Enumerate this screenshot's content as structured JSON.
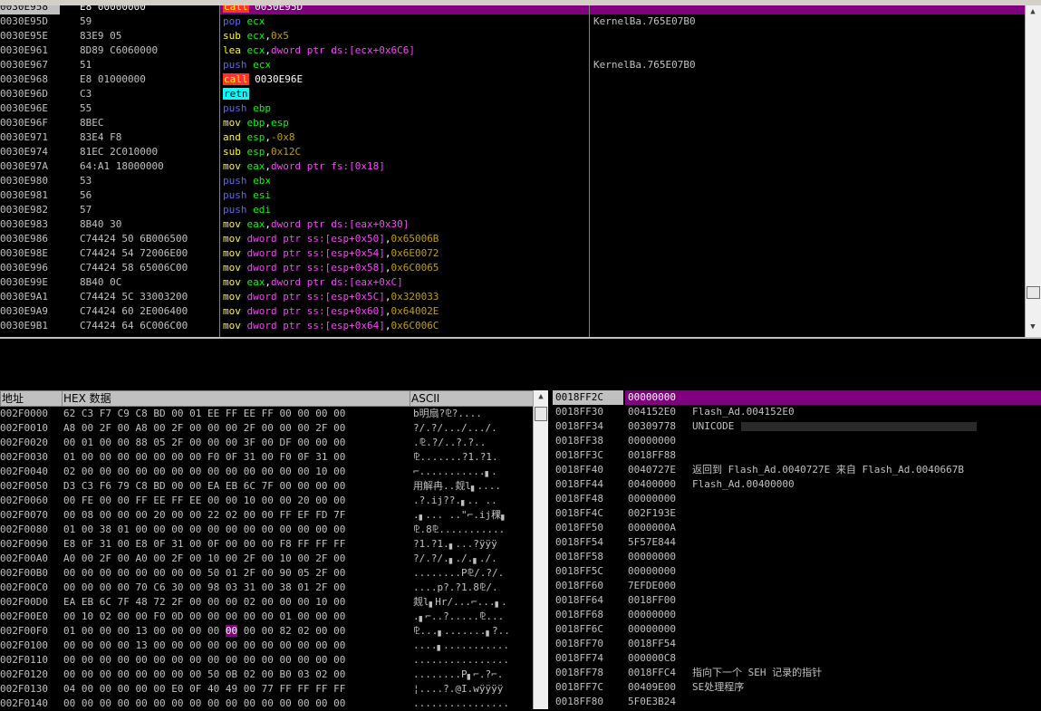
{
  "disasm": {
    "rows": [
      {
        "addr": "0030E958",
        "hex": "E8 00000000",
        "asm": [
          {
            "t": "call",
            "c": "kw-call"
          },
          {
            "t": " 0030E95D",
            "c": "op-plain"
          }
        ],
        "comment": ""
      },
      {
        "addr": "0030E95D",
        "hex": "59",
        "asm": [
          {
            "t": "pop",
            "c": "kw-pop"
          },
          {
            "t": " ecx",
            "c": "op-reg"
          }
        ],
        "comment": "KernelBa.765E07B0"
      },
      {
        "addr": "0030E95E",
        "hex": "83E9 05",
        "asm": [
          {
            "t": "sub",
            "c": "kw-arith"
          },
          {
            "t": " ecx",
            "c": "op-reg"
          },
          {
            "t": ",",
            "c": "op-plain"
          },
          {
            "t": "0x5",
            "c": "op-imm"
          }
        ],
        "comment": ""
      },
      {
        "addr": "0030E961",
        "hex": "8D89 C6060000",
        "asm": [
          {
            "t": "lea",
            "c": "kw-mov"
          },
          {
            "t": " ecx",
            "c": "op-reg"
          },
          {
            "t": ",",
            "c": "op-plain"
          },
          {
            "t": "dword ptr ds:[ecx+0x6C6]",
            "c": "op-mem"
          }
        ],
        "comment": ""
      },
      {
        "addr": "0030E967",
        "hex": "51",
        "asm": [
          {
            "t": "push",
            "c": "kw-push"
          },
          {
            "t": " ecx",
            "c": "op-reg"
          }
        ],
        "comment": "KernelBa.765E07B0"
      },
      {
        "addr": "0030E968",
        "hex": "E8 01000000",
        "asm": [
          {
            "t": "call",
            "c": "kw-call"
          },
          {
            "t": " 0030E96E",
            "c": "op-plain"
          }
        ],
        "comment": ""
      },
      {
        "addr": "0030E96D",
        "hex": "C3",
        "asm": [
          {
            "t": "retn",
            "c": "kw-retn"
          }
        ],
        "comment": ""
      },
      {
        "addr": "0030E96E",
        "hex": "55",
        "asm": [
          {
            "t": "push",
            "c": "kw-push"
          },
          {
            "t": " ebp",
            "c": "op-reg"
          }
        ],
        "comment": ""
      },
      {
        "addr": "0030E96F",
        "hex": "8BEC",
        "asm": [
          {
            "t": "mov",
            "c": "kw-mov"
          },
          {
            "t": " ebp",
            "c": "op-reg"
          },
          {
            "t": ",",
            "c": "op-plain"
          },
          {
            "t": "esp",
            "c": "op-reg"
          }
        ],
        "comment": ""
      },
      {
        "addr": "0030E971",
        "hex": "83E4 F8",
        "asm": [
          {
            "t": "and",
            "c": "kw-arith"
          },
          {
            "t": " esp",
            "c": "op-reg"
          },
          {
            "t": ",",
            "c": "op-plain"
          },
          {
            "t": "-0x8",
            "c": "op-imm"
          }
        ],
        "comment": ""
      },
      {
        "addr": "0030E974",
        "hex": "81EC 2C010000",
        "asm": [
          {
            "t": "sub",
            "c": "kw-arith"
          },
          {
            "t": " esp",
            "c": "op-reg"
          },
          {
            "t": ",",
            "c": "op-plain"
          },
          {
            "t": "0x12C",
            "c": "op-imm"
          }
        ],
        "comment": ""
      },
      {
        "addr": "0030E97A",
        "hex": "64:A1 18000000",
        "asm": [
          {
            "t": "mov",
            "c": "kw-mov"
          },
          {
            "t": " eax",
            "c": "op-reg"
          },
          {
            "t": ",",
            "c": "op-plain"
          },
          {
            "t": "dword ptr fs:[0x18]",
            "c": "op-mem"
          }
        ],
        "comment": ""
      },
      {
        "addr": "0030E980",
        "hex": "53",
        "asm": [
          {
            "t": "push",
            "c": "kw-push"
          },
          {
            "t": " ebx",
            "c": "op-reg"
          }
        ],
        "comment": ""
      },
      {
        "addr": "0030E981",
        "hex": "56",
        "asm": [
          {
            "t": "push",
            "c": "kw-push"
          },
          {
            "t": " esi",
            "c": "op-reg"
          }
        ],
        "comment": ""
      },
      {
        "addr": "0030E982",
        "hex": "57",
        "asm": [
          {
            "t": "push",
            "c": "kw-push"
          },
          {
            "t": " edi",
            "c": "op-reg"
          }
        ],
        "comment": ""
      },
      {
        "addr": "0030E983",
        "hex": "8B40 30",
        "asm": [
          {
            "t": "mov",
            "c": "kw-mov"
          },
          {
            "t": " eax",
            "c": "op-reg"
          },
          {
            "t": ",",
            "c": "op-plain"
          },
          {
            "t": "dword ptr ds:[eax+0x30]",
            "c": "op-mem"
          }
        ],
        "comment": ""
      },
      {
        "addr": "0030E986",
        "hex": "C74424 50 6B006500",
        "asm": [
          {
            "t": "mov",
            "c": "kw-mov"
          },
          {
            "t": " dword ptr ss:[esp+0x50]",
            "c": "op-mem"
          },
          {
            "t": ",",
            "c": "op-plain"
          },
          {
            "t": "0x65006B",
            "c": "op-imm"
          }
        ],
        "comment": ""
      },
      {
        "addr": "0030E98E",
        "hex": "C74424 54 72006E00",
        "asm": [
          {
            "t": "mov",
            "c": "kw-mov"
          },
          {
            "t": " dword ptr ss:[esp+0x54]",
            "c": "op-mem"
          },
          {
            "t": ",",
            "c": "op-plain"
          },
          {
            "t": "0x6E0072",
            "c": "op-imm"
          }
        ],
        "comment": ""
      },
      {
        "addr": "0030E996",
        "hex": "C74424 58 65006C00",
        "asm": [
          {
            "t": "mov",
            "c": "kw-mov"
          },
          {
            "t": " dword ptr ss:[esp+0x58]",
            "c": "op-mem"
          },
          {
            "t": ",",
            "c": "op-plain"
          },
          {
            "t": "0x6C0065",
            "c": "op-imm"
          }
        ],
        "comment": ""
      },
      {
        "addr": "0030E99E",
        "hex": "8B40 0C",
        "asm": [
          {
            "t": "mov",
            "c": "kw-mov"
          },
          {
            "t": " eax",
            "c": "op-reg"
          },
          {
            "t": ",",
            "c": "op-plain"
          },
          {
            "t": "dword ptr ds:[eax+0xC]",
            "c": "op-mem"
          }
        ],
        "comment": ""
      },
      {
        "addr": "0030E9A1",
        "hex": "C74424 5C 33003200",
        "asm": [
          {
            "t": "mov",
            "c": "kw-mov"
          },
          {
            "t": " dword ptr ss:[esp+0x5C]",
            "c": "op-mem"
          },
          {
            "t": ",",
            "c": "op-plain"
          },
          {
            "t": "0x320033",
            "c": "op-imm"
          }
        ],
        "comment": ""
      },
      {
        "addr": "0030E9A9",
        "hex": "C74424 60 2E006400",
        "asm": [
          {
            "t": "mov",
            "c": "kw-mov"
          },
          {
            "t": " dword ptr ss:[esp+0x60]",
            "c": "op-mem"
          },
          {
            "t": ",",
            "c": "op-plain"
          },
          {
            "t": "0x64002E",
            "c": "op-imm"
          }
        ],
        "comment": ""
      },
      {
        "addr": "0030E9B1",
        "hex": "C74424 64 6C006C00",
        "asm": [
          {
            "t": "mov",
            "c": "kw-mov"
          },
          {
            "t": " dword ptr ss:[esp+0x64]",
            "c": "op-mem"
          },
          {
            "t": ",",
            "c": "op-plain"
          },
          {
            "t": "0x6C006C",
            "c": "op-imm"
          }
        ],
        "comment": ""
      }
    ]
  },
  "dump": {
    "header_addr": "地址",
    "header_hex": "HEX 数据",
    "header_ascii": "ASCII",
    "rows": [
      {
        "addr": "002F0000",
        "hex": [
          "62",
          "C3",
          "F7",
          "C9",
          "C8",
          "BD",
          "00",
          "01",
          "EE",
          "FF",
          "EE",
          "FF",
          "00",
          "00",
          "00",
          "00"
        ],
        "ascii": "b明扇?⅊?...."
      },
      {
        "addr": "002F0010",
        "hex": [
          "A8",
          "00",
          "2F",
          "00",
          "A8",
          "00",
          "2F",
          "00",
          "00",
          "00",
          "2F",
          "00",
          "00",
          "00",
          "2F",
          "00"
        ],
        "ascii": "?/.?/.../.../."
      },
      {
        "addr": "002F0020",
        "hex": [
          "00",
          "01",
          "00",
          "00",
          "88",
          "05",
          "2F",
          "00",
          "00",
          "00",
          "3F",
          "00",
          "DF",
          "00",
          "00",
          "00"
        ],
        "ascii": ".⅊.?/..?.?.."
      },
      {
        "addr": "002F0030",
        "hex": [
          "01",
          "00",
          "00",
          "00",
          "00",
          "00",
          "00",
          "00",
          "F0",
          "0F",
          "31",
          "00",
          "F0",
          "0F",
          "31",
          "00"
        ],
        "ascii": "⅊.......?1.?1."
      },
      {
        "addr": "002F0040",
        "hex": [
          "02",
          "00",
          "00",
          "00",
          "00",
          "00",
          "00",
          "00",
          "00",
          "00",
          "00",
          "00",
          "00",
          "00",
          "10",
          "00"
        ],
        "ascii": "⌐...........▖."
      },
      {
        "addr": "002F0050",
        "hex": [
          "D3",
          "C3",
          "F6",
          "79",
          "C8",
          "BD",
          "00",
          "00",
          "EA",
          "EB",
          "6C",
          "7F",
          "00",
          "00",
          "00",
          "00"
        ],
        "ascii": "用解冉..觌l▖...."
      },
      {
        "addr": "002F0060",
        "hex": [
          "00",
          "FE",
          "00",
          "00",
          "FF",
          "EE",
          "FF",
          "EE",
          "00",
          "00",
          "10",
          "00",
          "00",
          "20",
          "00",
          "00"
        ],
        "ascii": ".?.ij??.▖.. .."
      },
      {
        "addr": "002F0070",
        "hex": [
          "00",
          "08",
          "00",
          "00",
          "00",
          "20",
          "00",
          "00",
          "22",
          "02",
          "00",
          "00",
          "FF",
          "EF",
          "FD",
          "7F"
        ],
        "ascii": ".▖... ..\"⌐.ij稞▖"
      },
      {
        "addr": "002F0080",
        "hex": [
          "01",
          "00",
          "38",
          "01",
          "00",
          "00",
          "00",
          "00",
          "00",
          "00",
          "00",
          "00",
          "00",
          "00",
          "00",
          "00"
        ],
        "ascii": "⅊.8⅊..........."
      },
      {
        "addr": "002F0090",
        "hex": [
          "E8",
          "0F",
          "31",
          "00",
          "E8",
          "0F",
          "31",
          "00",
          "0F",
          "00",
          "00",
          "00",
          "F8",
          "FF",
          "FF",
          "FF"
        ],
        "ascii": "?1.?1.▖...?ÿÿÿ"
      },
      {
        "addr": "002F00A0",
        "hex": [
          "A0",
          "00",
          "2F",
          "00",
          "A0",
          "00",
          "2F",
          "00",
          "10",
          "00",
          "2F",
          "00",
          "10",
          "00",
          "2F",
          "00"
        ],
        "ascii": "?/.?/.▖./.▖./."
      },
      {
        "addr": "002F00B0",
        "hex": [
          "00",
          "00",
          "00",
          "00",
          "00",
          "00",
          "00",
          "00",
          "50",
          "01",
          "2F",
          "00",
          "90",
          "05",
          "2F",
          "00"
        ],
        "ascii": "........P⅊/.?/."
      },
      {
        "addr": "002F00C0",
        "hex": [
          "00",
          "00",
          "00",
          "00",
          "70",
          "C6",
          "30",
          "00",
          "98",
          "03",
          "31",
          "00",
          "38",
          "01",
          "2F",
          "00"
        ],
        "ascii": "....p?.?1.8⅊/."
      },
      {
        "addr": "002F00D0",
        "hex": [
          "EA",
          "EB",
          "6C",
          "7F",
          "48",
          "72",
          "2F",
          "00",
          "00",
          "00",
          "02",
          "00",
          "00",
          "00",
          "10",
          "00"
        ],
        "ascii": "觌l▖Hr/...⌐...▖."
      },
      {
        "addr": "002F00E0",
        "hex": [
          "00",
          "10",
          "02",
          "00",
          "00",
          "F0",
          "0D",
          "00",
          "00",
          "00",
          "00",
          "00",
          "01",
          "00",
          "00",
          "00"
        ],
        "ascii": ".▖⌐..?.....⅊..."
      },
      {
        "addr": "002F00F0",
        "hex": [
          "01",
          "00",
          "00",
          "00",
          "13",
          "00",
          "00",
          "00",
          "00",
          "00",
          "00",
          "00",
          "82",
          "02",
          "00",
          "00"
        ],
        "ascii": "⅊...▖.......▖?.."
      },
      {
        "addr": "002F0100",
        "hex": [
          "00",
          "00",
          "00",
          "00",
          "13",
          "00",
          "00",
          "00",
          "00",
          "00",
          "00",
          "00",
          "00",
          "00",
          "00",
          "00"
        ],
        "ascii": "....▖..........."
      },
      {
        "addr": "002F0110",
        "hex": [
          "00",
          "00",
          "00",
          "00",
          "00",
          "00",
          "00",
          "00",
          "00",
          "00",
          "00",
          "00",
          "00",
          "00",
          "00",
          "00"
        ],
        "ascii": "................"
      },
      {
        "addr": "002F0120",
        "hex": [
          "00",
          "00",
          "00",
          "00",
          "00",
          "00",
          "00",
          "00",
          "50",
          "0B",
          "02",
          "00",
          "B0",
          "03",
          "02",
          "00"
        ],
        "ascii": "........P▖⌐.?⌐."
      },
      {
        "addr": "002F0130",
        "hex": [
          "04",
          "00",
          "00",
          "00",
          "00",
          "00",
          "E0",
          "0F",
          "40",
          "49",
          "00",
          "77",
          "FF",
          "FF",
          "FF",
          "FF"
        ],
        "ascii": "¦....?.@I.wÿÿÿÿ"
      },
      {
        "addr": "002F0140",
        "hex": [
          "00",
          "00",
          "00",
          "00",
          "00",
          "00",
          "00",
          "00",
          "00",
          "00",
          "00",
          "00",
          "00",
          "00",
          "00",
          "00"
        ],
        "ascii": "................"
      }
    ],
    "selected_index": [
      15,
      9
    ]
  },
  "stack": {
    "rows": [
      {
        "addr": "0018FF2C",
        "val": "00000000",
        "comment": ""
      },
      {
        "addr": "0018FF30",
        "val": "004152E0",
        "comment": "Flash_Ad.004152E0"
      },
      {
        "addr": "0018FF34",
        "val": "00309778",
        "comment": "UNICODE"
      },
      {
        "addr": "0018FF38",
        "val": "00000000",
        "comment": ""
      },
      {
        "addr": "0018FF3C",
        "val": "0018FF88",
        "comment": ""
      },
      {
        "addr": "0018FF40",
        "val": "0040727E",
        "comment": "返回到 Flash_Ad.0040727E 来自 Flash_Ad.0040667B"
      },
      {
        "addr": "0018FF44",
        "val": "00400000",
        "comment": "Flash_Ad.00400000"
      },
      {
        "addr": "0018FF48",
        "val": "00000000",
        "comment": ""
      },
      {
        "addr": "0018FF4C",
        "val": "002F193E",
        "comment": ""
      },
      {
        "addr": "0018FF50",
        "val": "0000000A",
        "comment": ""
      },
      {
        "addr": "0018FF54",
        "val": "5F57E844",
        "comment": ""
      },
      {
        "addr": "0018FF58",
        "val": "00000000",
        "comment": ""
      },
      {
        "addr": "0018FF5C",
        "val": "00000000",
        "comment": ""
      },
      {
        "addr": "0018FF60",
        "val": "7EFDE000",
        "comment": ""
      },
      {
        "addr": "0018FF64",
        "val": "0018FF00",
        "comment": ""
      },
      {
        "addr": "0018FF68",
        "val": "00000000",
        "comment": ""
      },
      {
        "addr": "0018FF6C",
        "val": "00000000",
        "comment": ""
      },
      {
        "addr": "0018FF70",
        "val": "0018FF54",
        "comment": ""
      },
      {
        "addr": "0018FF74",
        "val": "000000C8",
        "comment": ""
      },
      {
        "addr": "0018FF78",
        "val": "0018FFC4",
        "comment": "指向下一个 SEH 记录的指针"
      },
      {
        "addr": "0018FF7C",
        "val": "00409E00",
        "comment": "SE处理程序"
      },
      {
        "addr": "0018FF80",
        "val": "5F0E3B24",
        "comment": ""
      }
    ]
  },
  "colors": {
    "selection": "#800080",
    "background": "#000000",
    "call_bg": "#ff3030",
    "retn_bg": "#00ffff"
  }
}
